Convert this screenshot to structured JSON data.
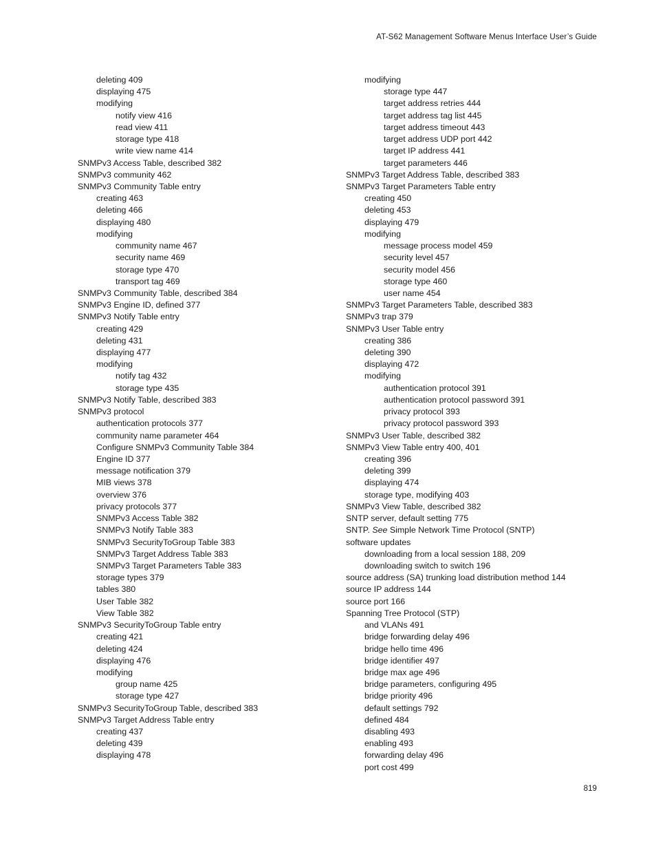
{
  "header": {
    "title": "AT-S62 Management Software Menus Interface User’s Guide"
  },
  "footer": {
    "page_number": "819"
  },
  "index": {
    "left_column": [
      {
        "level": 1,
        "text": "deleting 409"
      },
      {
        "level": 1,
        "text": "displaying 475"
      },
      {
        "level": 1,
        "text": "modifying"
      },
      {
        "level": 2,
        "text": "notify view 416"
      },
      {
        "level": 2,
        "text": "read view 411"
      },
      {
        "level": 2,
        "text": "storage type 418"
      },
      {
        "level": 2,
        "text": "write view name 414"
      },
      {
        "level": 0,
        "text": "SNMPv3 Access Table, described 382"
      },
      {
        "level": 0,
        "text": "SNMPv3 community 462"
      },
      {
        "level": 0,
        "text": "SNMPv3 Community Table entry"
      },
      {
        "level": 1,
        "text": "creating 463"
      },
      {
        "level": 1,
        "text": "deleting 466"
      },
      {
        "level": 1,
        "text": "displaying 480"
      },
      {
        "level": 1,
        "text": "modifying"
      },
      {
        "level": 2,
        "text": "community name 467"
      },
      {
        "level": 2,
        "text": "security name 469"
      },
      {
        "level": 2,
        "text": "storage type 470"
      },
      {
        "level": 2,
        "text": "transport tag 469"
      },
      {
        "level": 0,
        "text": "SNMPv3 Community Table, described 384"
      },
      {
        "level": 0,
        "text": "SNMPv3 Engine ID, defined 377"
      },
      {
        "level": 0,
        "text": "SNMPv3 Notify Table entry"
      },
      {
        "level": 1,
        "text": "creating 429"
      },
      {
        "level": 1,
        "text": "deleting 431"
      },
      {
        "level": 1,
        "text": "displaying 477"
      },
      {
        "level": 1,
        "text": "modifying"
      },
      {
        "level": 2,
        "text": "notify tag 432"
      },
      {
        "level": 2,
        "text": "storage type 435"
      },
      {
        "level": 0,
        "text": "SNMPv3 Notify Table, described 383"
      },
      {
        "level": 0,
        "text": "SNMPv3 protocol"
      },
      {
        "level": 1,
        "text": "authentication protocols 377"
      },
      {
        "level": 1,
        "text": "community name parameter 464"
      },
      {
        "level": 1,
        "text": "Configure SNMPv3 Community Table 384"
      },
      {
        "level": 1,
        "text": "Engine ID 377"
      },
      {
        "level": 1,
        "text": "message notification 379"
      },
      {
        "level": 1,
        "text": "MIB views 378"
      },
      {
        "level": 1,
        "text": "overview 376"
      },
      {
        "level": 1,
        "text": "privacy protocols 377"
      },
      {
        "level": 1,
        "text": "SNMPv3 Access Table 382"
      },
      {
        "level": 1,
        "text": "SNMPv3 Notify Table 383"
      },
      {
        "level": 1,
        "text": "SNMPv3 SecurityToGroup Table 383"
      },
      {
        "level": 1,
        "text": "SNMPv3 Target Address Table 383"
      },
      {
        "level": 1,
        "text": "SNMPv3 Target Parameters Table 383"
      },
      {
        "level": 1,
        "text": "storage types 379"
      },
      {
        "level": 1,
        "text": "tables 380"
      },
      {
        "level": 1,
        "text": "User Table 382"
      },
      {
        "level": 1,
        "text": "View Table 382"
      },
      {
        "level": 0,
        "text": "SNMPv3 SecurityToGroup Table entry"
      },
      {
        "level": 1,
        "text": "creating 421"
      },
      {
        "level": 1,
        "text": "deleting 424"
      },
      {
        "level": 1,
        "text": "displaying 476"
      },
      {
        "level": 1,
        "text": "modifying"
      },
      {
        "level": 2,
        "text": "group name 425"
      },
      {
        "level": 2,
        "text": "storage type 427"
      },
      {
        "level": 0,
        "text": "SNMPv3 SecurityToGroup Table, described 383"
      },
      {
        "level": 0,
        "text": "SNMPv3 Target Address Table entry"
      },
      {
        "level": 1,
        "text": "creating 437"
      },
      {
        "level": 1,
        "text": "deleting 439"
      },
      {
        "level": 1,
        "text": "displaying 478"
      }
    ],
    "right_column": [
      {
        "level": 1,
        "text": "modifying"
      },
      {
        "level": 2,
        "text": "storage type 447"
      },
      {
        "level": 2,
        "text": "target address retries 444"
      },
      {
        "level": 2,
        "text": "target address tag list 445"
      },
      {
        "level": 2,
        "text": "target address timeout 443"
      },
      {
        "level": 2,
        "text": "target address UDP port 442"
      },
      {
        "level": 2,
        "text": "target IP address 441"
      },
      {
        "level": 2,
        "text": "target parameters 446"
      },
      {
        "level": 0,
        "text": "SNMPv3 Target Address Table, described 383"
      },
      {
        "level": 0,
        "text": "SNMPv3 Target Parameters Table entry"
      },
      {
        "level": 1,
        "text": "creating 450"
      },
      {
        "level": 1,
        "text": "deleting 453"
      },
      {
        "level": 1,
        "text": "displaying 479"
      },
      {
        "level": 1,
        "text": "modifying"
      },
      {
        "level": 2,
        "text": "message process model 459"
      },
      {
        "level": 2,
        "text": "security level 457"
      },
      {
        "level": 2,
        "text": "security model 456"
      },
      {
        "level": 2,
        "text": "storage type 460"
      },
      {
        "level": 2,
        "text": "user name 454"
      },
      {
        "level": 0,
        "text": "SNMPv3 Target Parameters Table, described 383"
      },
      {
        "level": 0,
        "text": "SNMPv3 trap 379"
      },
      {
        "level": 0,
        "text": "SNMPv3 User Table entry"
      },
      {
        "level": 1,
        "text": "creating 386"
      },
      {
        "level": 1,
        "text": "deleting 390"
      },
      {
        "level": 1,
        "text": "displaying 472"
      },
      {
        "level": 1,
        "text": "modifying"
      },
      {
        "level": 2,
        "text": "authentication protocol 391"
      },
      {
        "level": 2,
        "text": "authentication protocol password 391"
      },
      {
        "level": 2,
        "text": "privacy protocol 393"
      },
      {
        "level": 2,
        "text": "privacy protocol password 393"
      },
      {
        "level": 0,
        "text": "SNMPv3 User Table, described 382"
      },
      {
        "level": 0,
        "text": "SNMPv3 View Table entry 400, 401"
      },
      {
        "level": 1,
        "text": "creating 396"
      },
      {
        "level": 1,
        "text": "deleting 399"
      },
      {
        "level": 1,
        "text": "displaying 474"
      },
      {
        "level": 1,
        "text": "storage type, modifying 403"
      },
      {
        "level": 0,
        "text": "SNMPv3 View Table, described 382"
      },
      {
        "level": 0,
        "text": "SNTP server, default setting 775"
      },
      {
        "level": 0,
        "text": "SNTP. See Simple Network Time Protocol (SNTP)",
        "italic_word": "See"
      },
      {
        "level": 0,
        "text": "software updates"
      },
      {
        "level": 1,
        "text": "downloading from a local session 188, 209"
      },
      {
        "level": 1,
        "text": "downloading switch to switch 196"
      },
      {
        "level": 0,
        "text": "source address (SA) trunking load distribution method 144"
      },
      {
        "level": 0,
        "text": "source IP address 144"
      },
      {
        "level": 0,
        "text": "source port 166"
      },
      {
        "level": 0,
        "text": "Spanning Tree Protocol (STP)"
      },
      {
        "level": 1,
        "text": "and VLANs 491"
      },
      {
        "level": 1,
        "text": "bridge forwarding delay 496"
      },
      {
        "level": 1,
        "text": "bridge hello time 496"
      },
      {
        "level": 1,
        "text": "bridge identifier 497"
      },
      {
        "level": 1,
        "text": "bridge max age 496"
      },
      {
        "level": 1,
        "text": "bridge parameters, configuring 495"
      },
      {
        "level": 1,
        "text": "bridge priority 496"
      },
      {
        "level": 1,
        "text": "default settings 792"
      },
      {
        "level": 1,
        "text": "defined 484"
      },
      {
        "level": 1,
        "text": "disabling 493"
      },
      {
        "level": 1,
        "text": "enabling 493"
      },
      {
        "level": 1,
        "text": "forwarding delay 496"
      },
      {
        "level": 1,
        "text": "port cost 499"
      }
    ]
  }
}
